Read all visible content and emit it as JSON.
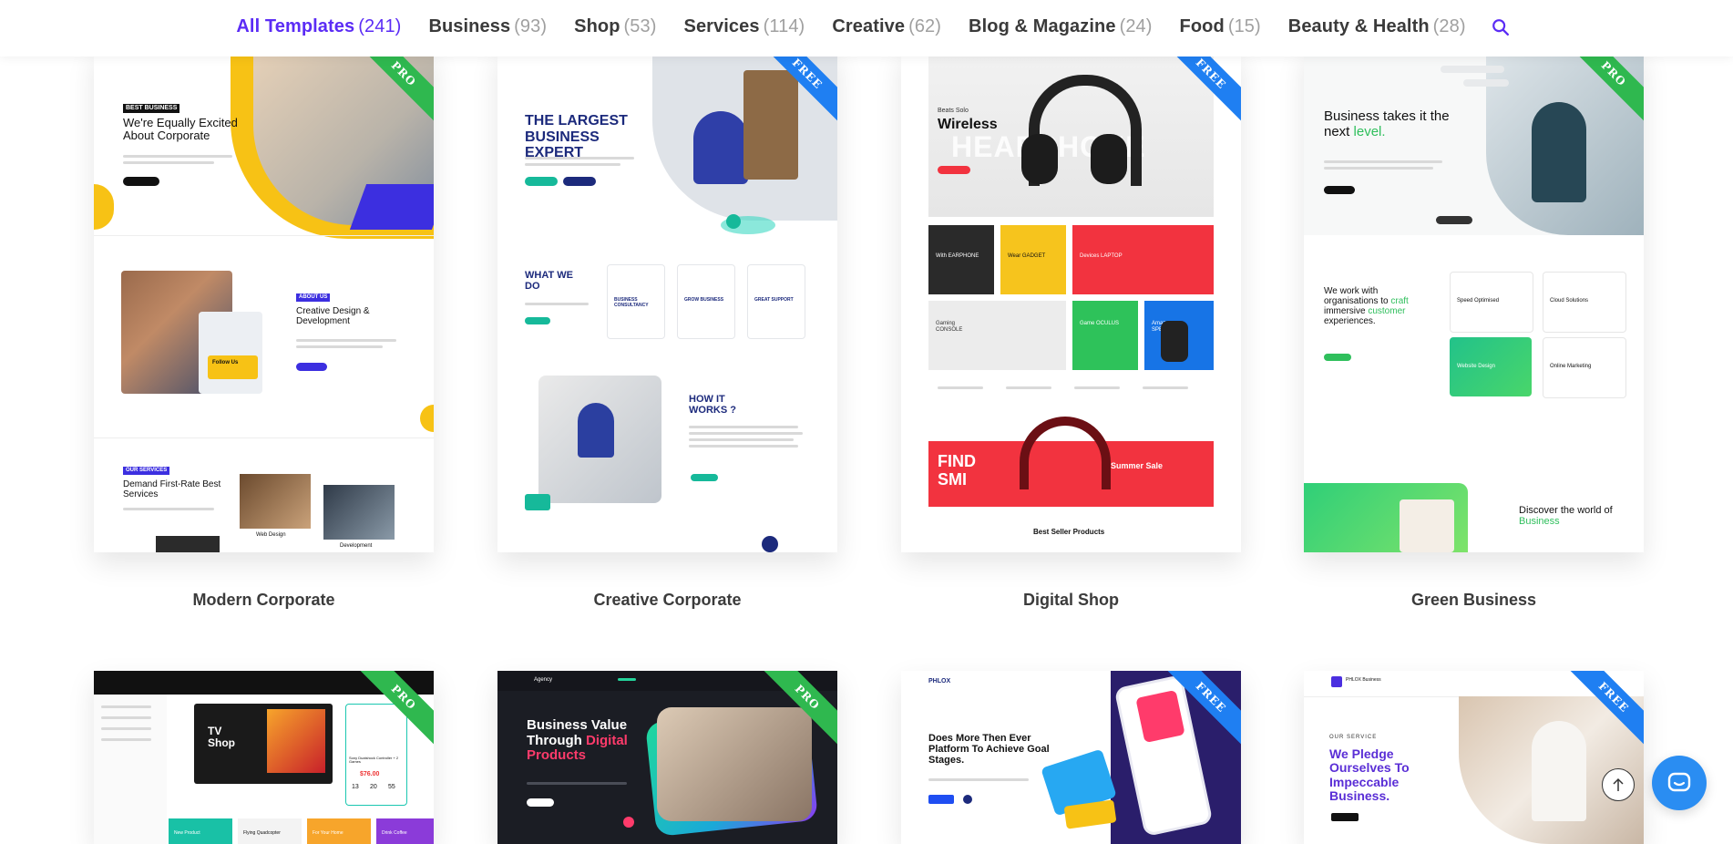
{
  "nav": {
    "items": [
      {
        "label": "All Templates",
        "count": "(241)"
      },
      {
        "label": "Business",
        "count": "(93)"
      },
      {
        "label": "Shop",
        "count": "(53)"
      },
      {
        "label": "Services",
        "count": "(114)"
      },
      {
        "label": "Creative",
        "count": "(62)"
      },
      {
        "label": "Blog & Magazine",
        "count": "(24)"
      },
      {
        "label": "Food",
        "count": "(15)"
      },
      {
        "label": "Beauty & Health",
        "count": "(28)"
      }
    ],
    "accent_color": "#5b2cf5"
  },
  "cards": [
    {
      "title": "Modern Corporate",
      "badge": "PRO"
    },
    {
      "title": "Creative Corporate",
      "badge": "FREE"
    },
    {
      "title": "Digital Shop",
      "badge": "FREE"
    },
    {
      "title": "Green Business",
      "badge": "PRO"
    },
    {
      "title": "",
      "badge": "PRO"
    },
    {
      "title": "",
      "badge": "PRO"
    },
    {
      "title": "",
      "badge": "FREE"
    },
    {
      "title": "",
      "badge": "FREE"
    }
  ],
  "thumbs": {
    "modern_corporate": {
      "logo": "BEST BUSINESS",
      "heading": "We're Equally Excited About Corporate",
      "section2_label": "ABOUT US",
      "section2_heading": "Creative Design & Development",
      "follow": "Follow Us",
      "section3_label": "OUR SERVICES",
      "section3_heading": "Demand First-Rate Best Services",
      "tag1": "Web Design",
      "tag2": "Development"
    },
    "creative_corporate": {
      "heading": "THE LARGEST BUSINESS EXPERT",
      "what": "WHAT WE DO",
      "services": [
        "BUSINESS CONSULTANCY",
        "GROW BUSINESS",
        "GREAT SUPPORT"
      ],
      "how": "HOW IT WORKS ?"
    },
    "digital_shop": {
      "kicker": "Beats Solo",
      "heading": "Wireless",
      "big": "HEADPHONE",
      "tiles": [
        "With EARPHONE",
        "Wear GADGET",
        "Devices LAPTOP",
        "Gaming CONSOLE",
        "Game OCULUS",
        "Amazon SPEAKER"
      ],
      "sale_left": "FIND SMI",
      "sale_right": "Summer Sale",
      "best": "Best Seller Products"
    },
    "green_business": {
      "heading": "Business takes it the next",
      "accent": "level.",
      "work": "We work with organisations to",
      "work_accent1": "craft",
      "work_mid": "immersive",
      "work_accent2": "customer",
      "work_end": "experiences.",
      "features": [
        "Speed Optimised",
        "Cloud Solutions",
        "Website Design",
        "Online Marketing"
      ],
      "discover": "Discover the world of",
      "discover_accent": "Business"
    },
    "tv_shop": {
      "heading": "TV Shop",
      "product": "Sony Dualshock Controller + 2 Games",
      "price": "$76.00",
      "timer": [
        "13",
        "20",
        "55"
      ],
      "tiles": [
        "New Product",
        "Flying Quadcopter",
        "For Your Home",
        "Drink Coffee"
      ]
    },
    "agency": {
      "brand": "Agency",
      "heading": "Business Value Through",
      "accent": "Digital Products"
    },
    "goal": {
      "brand": "PHLOX",
      "heading": "Does More Then Ever Platform To Achieve Goal Stages."
    },
    "pledge": {
      "brand": "PHLOX Business",
      "kicker": "OUR SERVICE",
      "heading": "We Pledge Ourselves To Impeccable Business."
    }
  }
}
